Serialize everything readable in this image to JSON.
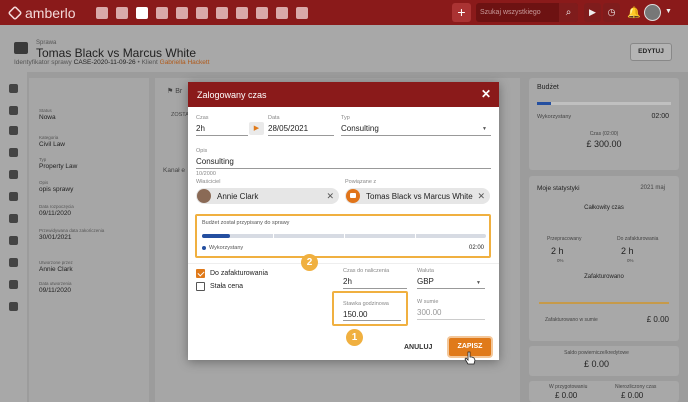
{
  "app": {
    "logo": "amberlo"
  },
  "topbar": {
    "search_placeholder": "Szukaj wszystkiego",
    "plus": "+"
  },
  "case": {
    "breadcrumb": "Sprawa",
    "title": "Tomas Black vs Marcus White",
    "id_label": "Identyfikator sprawy",
    "id_value": "CASE-2020-11-09-26",
    "client_label": "Klient",
    "client_value": "Gabriella Hackett",
    "edit_button": "EDYTUJ"
  },
  "left_panel": {
    "status_label": "Status",
    "status_value": "Nowa",
    "category_label": "Kategoria",
    "category_value": "Civil Law",
    "type_label": "Typ",
    "type_value": "Property Law",
    "description_label": "Opis",
    "description_value": "opis sprawy",
    "start_label": "Data rozpoczęcia",
    "start_value": "09/11/2020",
    "planned_end_label": "Przewidywana data zakończenia",
    "planned_end_value": "30/01/2021",
    "created_by_label": "Utworzone przez",
    "created_by_value": "Annie Clark",
    "created_date_label": "Data utworzenia",
    "created_date_value": "09/11/2020"
  },
  "center_panel": {
    "tab_prefix": "Br",
    "sub_tab": "ZOSTA",
    "row_label": "Kanał e"
  },
  "right_panel": {
    "budget_title": "Budżet",
    "budget_used_label": "Wykorzystany",
    "budget_used_value": "02:00",
    "budget_time_label": "Czas (02:00)",
    "budget_amount": "£ 300.00",
    "stats_title": "Moje statystyki",
    "stats_period": "2021 maj",
    "total_time_label": "Całkowity czas",
    "worked_label": "Przepracowany",
    "worked_value": "2 h",
    "worked_pct": "0%",
    "to_invoice_label": "Do zafakturowania",
    "to_invoice_value": "2 h",
    "to_invoice_pct": "0%",
    "invoiced_label": "Zafakturowano",
    "invoiced_sum_label": "Zafakturowano w sumie",
    "invoiced_sum_value": "£ 0.00",
    "prepaid_label": "Saldo powiernicze/kredytowe",
    "prepaid_value": "£ 0.00",
    "in_prep_label": "W przygotowaniu",
    "in_prep_value": "£ 0.00",
    "unpaid_label": "Nierozliczony czas",
    "unpaid_value": "£ 0.00"
  },
  "modal": {
    "title": "Zalogowany czas",
    "time_label": "Czas",
    "time_value": "2h",
    "date_label": "Data",
    "date_value": "28/05/2021",
    "type_label": "Typ",
    "type_value": "Consulting",
    "desc_label": "Opis",
    "desc_value": "Consulting",
    "desc_counter": "10/2000",
    "owner_label": "Właściciel",
    "owner_value": "Annie Clark",
    "related_label": "Powiązane z",
    "related_value": "Tomas Black vs Marcus White",
    "budget_text": "Budżet został przypisany do sprawy",
    "budget_used_label": "Wykorzystany",
    "budget_used_value": "02:00",
    "budget_fill_fraction": 0.1,
    "invoice_label": "Do zafakturowania",
    "invoice_checked": true,
    "fixed_price_label": "Stała cena",
    "fixed_price_checked": false,
    "bill_time_label": "Czas do naliczenia",
    "bill_time_value": "2h",
    "currency_label": "Waluta",
    "currency_value": "GBP",
    "hourly_rate_label": "Stawka godzinowa",
    "hourly_rate_value": "150.00",
    "total_label": "W sumie",
    "total_value": "300.00",
    "cancel_button": "ANULUJ",
    "save_button": "ZAPISZ"
  },
  "annotations": {
    "badge_1": "1",
    "badge_2": "2"
  },
  "colors": {
    "brand": "#8a1a1a",
    "accent": "#e07a1a",
    "highlight": "#f0b040",
    "progress": "#244fa0"
  }
}
